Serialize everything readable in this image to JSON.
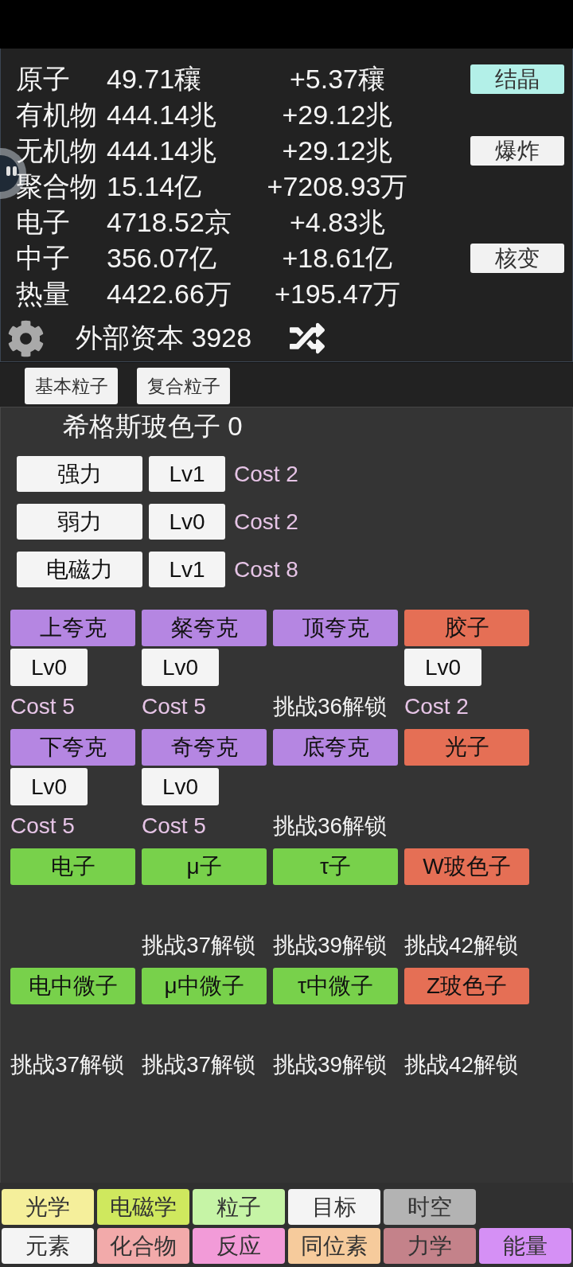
{
  "resources": [
    {
      "name": "原子",
      "amount": "49.71穰",
      "rate": "+5.37穰",
      "action": {
        "label": "结晶",
        "kind": "accent"
      }
    },
    {
      "name": "有机物",
      "amount": "444.14兆",
      "rate": "+29.12兆"
    },
    {
      "name": "无机物",
      "amount": "444.14兆",
      "rate": "+29.12兆",
      "action": {
        "label": "爆炸",
        "kind": "plain"
      }
    },
    {
      "name": "聚合物",
      "amount": "15.14亿",
      "rate": "+7208.93万"
    },
    {
      "name": "电子",
      "amount": "4718.52京",
      "rate": "+4.83兆"
    },
    {
      "name": "中子",
      "amount": "356.07亿",
      "rate": "+18.61亿",
      "action": {
        "label": "核变",
        "kind": "plain"
      }
    },
    {
      "name": "热量",
      "amount": "4422.66万",
      "rate": "+195.47万"
    }
  ],
  "capital": "外部资本 3928",
  "subtabs": [
    {
      "label": "基本粒子"
    },
    {
      "label": "复合粒子"
    }
  ],
  "higgs": "希格斯玻色子 0",
  "forces": [
    {
      "name": "强力",
      "lv": "Lv1",
      "cost": "Cost 2"
    },
    {
      "name": "弱力",
      "lv": "Lv0",
      "cost": "Cost 2"
    },
    {
      "name": "电磁力",
      "lv": "Lv1",
      "cost": "Cost 8"
    }
  ],
  "particle_rows": [
    {
      "cells": [
        {
          "name": "上夸克",
          "kind": "quark",
          "lv": "Lv0",
          "note": {
            "kind": "cost",
            "text": "Cost 5"
          }
        },
        {
          "name": "粲夸克",
          "kind": "quark",
          "lv": "Lv0",
          "note": {
            "kind": "cost",
            "text": "Cost 5"
          }
        },
        {
          "name": "顶夸克",
          "kind": "quark",
          "note": {
            "kind": "unlock",
            "text": "挑战36解锁"
          }
        },
        {
          "name": "胶子",
          "kind": "boson",
          "lv": "Lv0",
          "note": {
            "kind": "cost",
            "text": "Cost 2"
          }
        }
      ]
    },
    {
      "cells": [
        {
          "name": "下夸克",
          "kind": "quark",
          "lv": "Lv0",
          "note": {
            "kind": "cost",
            "text": "Cost 5"
          }
        },
        {
          "name": "奇夸克",
          "kind": "quark",
          "lv": "Lv0",
          "note": {
            "kind": "cost",
            "text": "Cost 5"
          }
        },
        {
          "name": "底夸克",
          "kind": "quark",
          "note": {
            "kind": "unlock",
            "text": "挑战36解锁"
          }
        },
        {
          "name": "光子",
          "kind": "boson"
        }
      ]
    },
    {
      "cells": [
        {
          "name": "电子",
          "kind": "lepton"
        },
        {
          "name": "μ子",
          "kind": "lepton",
          "note": {
            "kind": "unlock",
            "text": "挑战37解锁"
          }
        },
        {
          "name": "τ子",
          "kind": "lepton",
          "note": {
            "kind": "unlock",
            "text": "挑战39解锁"
          }
        },
        {
          "name": "W玻色子",
          "kind": "boson",
          "note": {
            "kind": "unlock",
            "text": "挑战42解锁"
          }
        }
      ]
    },
    {
      "cells": [
        {
          "name": "电中微子",
          "kind": "lepton",
          "note": {
            "kind": "unlock",
            "text": "挑战37解锁"
          }
        },
        {
          "name": "μ中微子",
          "kind": "lepton",
          "note": {
            "kind": "unlock",
            "text": "挑战37解锁"
          }
        },
        {
          "name": "τ中微子",
          "kind": "lepton",
          "note": {
            "kind": "unlock",
            "text": "挑战39解锁"
          }
        },
        {
          "name": "Z玻色子",
          "kind": "boson",
          "note": {
            "kind": "unlock",
            "text": "挑战42解锁"
          }
        }
      ]
    }
  ],
  "nav_rows": [
    {
      "tabs": [
        {
          "label": "光学",
          "color": "#f5ef9b"
        },
        {
          "label": "电磁学",
          "color": "#cfe85e"
        },
        {
          "label": "粒子",
          "color": "#c6f4a6"
        },
        {
          "label": "目标",
          "color": "#f4f4f4"
        },
        {
          "label": "时空",
          "color": "#b3b3b3"
        }
      ]
    },
    {
      "tabs": [
        {
          "label": "元素",
          "color": "#f4f4f4"
        },
        {
          "label": "化合物",
          "color": "#f2aaaa"
        },
        {
          "label": "反应",
          "color": "#f29bd8"
        },
        {
          "label": "同位素",
          "color": "#f6cb9c"
        },
        {
          "label": "力学",
          "color": "#c4828a"
        },
        {
          "label": "能量",
          "color": "#d590f5"
        }
      ]
    }
  ]
}
